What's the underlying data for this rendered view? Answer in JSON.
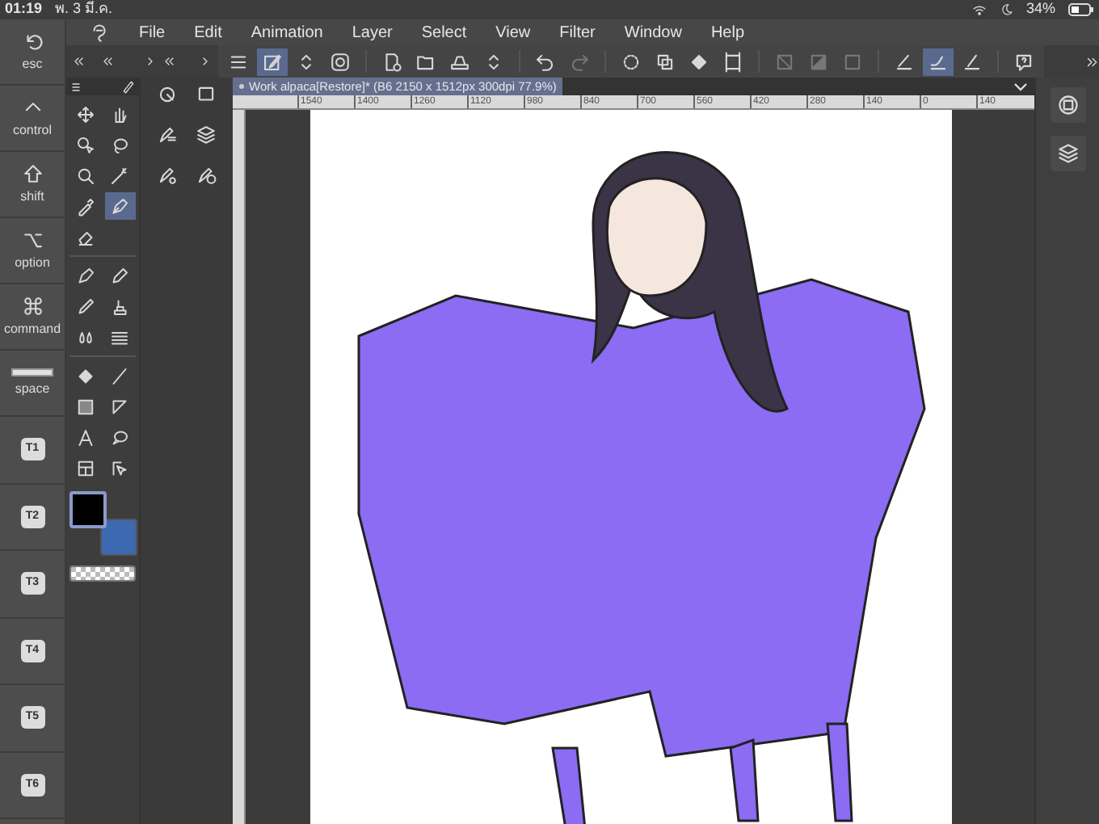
{
  "status_bar": {
    "time": "01:19",
    "date": "พ. 3 มี.ค.",
    "battery": "34%"
  },
  "modifier_keys": [
    {
      "label": "esc",
      "kind": "undo"
    },
    {
      "label": "control",
      "kind": "caret"
    },
    {
      "label": "shift",
      "kind": "shift"
    },
    {
      "label": "option",
      "kind": "option"
    },
    {
      "label": "command",
      "kind": "command"
    },
    {
      "label": "space",
      "kind": "space"
    },
    {
      "label": "T1",
      "kind": "text"
    },
    {
      "label": "T2",
      "kind": "text"
    },
    {
      "label": "T3",
      "kind": "text"
    },
    {
      "label": "T4",
      "kind": "text"
    },
    {
      "label": "T5",
      "kind": "text"
    },
    {
      "label": "T6",
      "kind": "text"
    }
  ],
  "menu": [
    "File",
    "Edit",
    "Animation",
    "Layer",
    "Select",
    "View",
    "Filter",
    "Window",
    "Help"
  ],
  "command_bar": [
    {
      "selected": false
    },
    {
      "selected": true
    },
    {
      "selected": false
    },
    {
      "selected": false
    },
    {
      "selected": false
    },
    {
      "selected": false
    },
    {
      "selected": false
    },
    {
      "selected": false
    },
    {
      "selected": false
    },
    {
      "selected": false
    },
    {
      "selected": false
    },
    {
      "selected": false
    },
    {
      "selected": false
    },
    {
      "selected": false
    },
    {
      "selected": false
    },
    {
      "selected": false
    },
    {
      "selected": false
    },
    {
      "selected": false
    },
    {
      "selected": true
    },
    {
      "selected": false
    },
    {
      "selected": false
    }
  ],
  "tools": [
    {
      "selected": false
    },
    {
      "selected": false
    },
    {
      "selected": false
    },
    {
      "selected": false
    },
    {
      "selected": false
    },
    {
      "selected": false
    },
    {
      "selected": false
    },
    {
      "selected": true
    },
    {
      "selected": false
    },
    {
      "selected": false
    },
    {
      "selected": false
    },
    {
      "selected": false
    },
    {
      "selected": false
    },
    {
      "selected": false
    },
    {
      "selected": false
    },
    {
      "selected": false
    },
    {
      "selected": false
    },
    {
      "selected": false
    },
    {
      "selected": false
    },
    {
      "selected": false
    },
    {
      "selected": false
    },
    {
      "selected": false
    },
    {
      "selected": false
    }
  ],
  "colors": [
    {
      "color": "#000000",
      "selected": true
    },
    {
      "color": "#3d68b2",
      "selected": false
    }
  ],
  "document_tab": {
    "title": "Work alpaca[Restore]* (B6 2150 x 1512px 300dpi 77.9%)",
    "selected": true
  },
  "ruler_labels": [
    "1540",
    "1400",
    "1260",
    "1120",
    "980",
    "840",
    "700",
    "560",
    "420",
    "280",
    "140",
    "0",
    "140"
  ]
}
